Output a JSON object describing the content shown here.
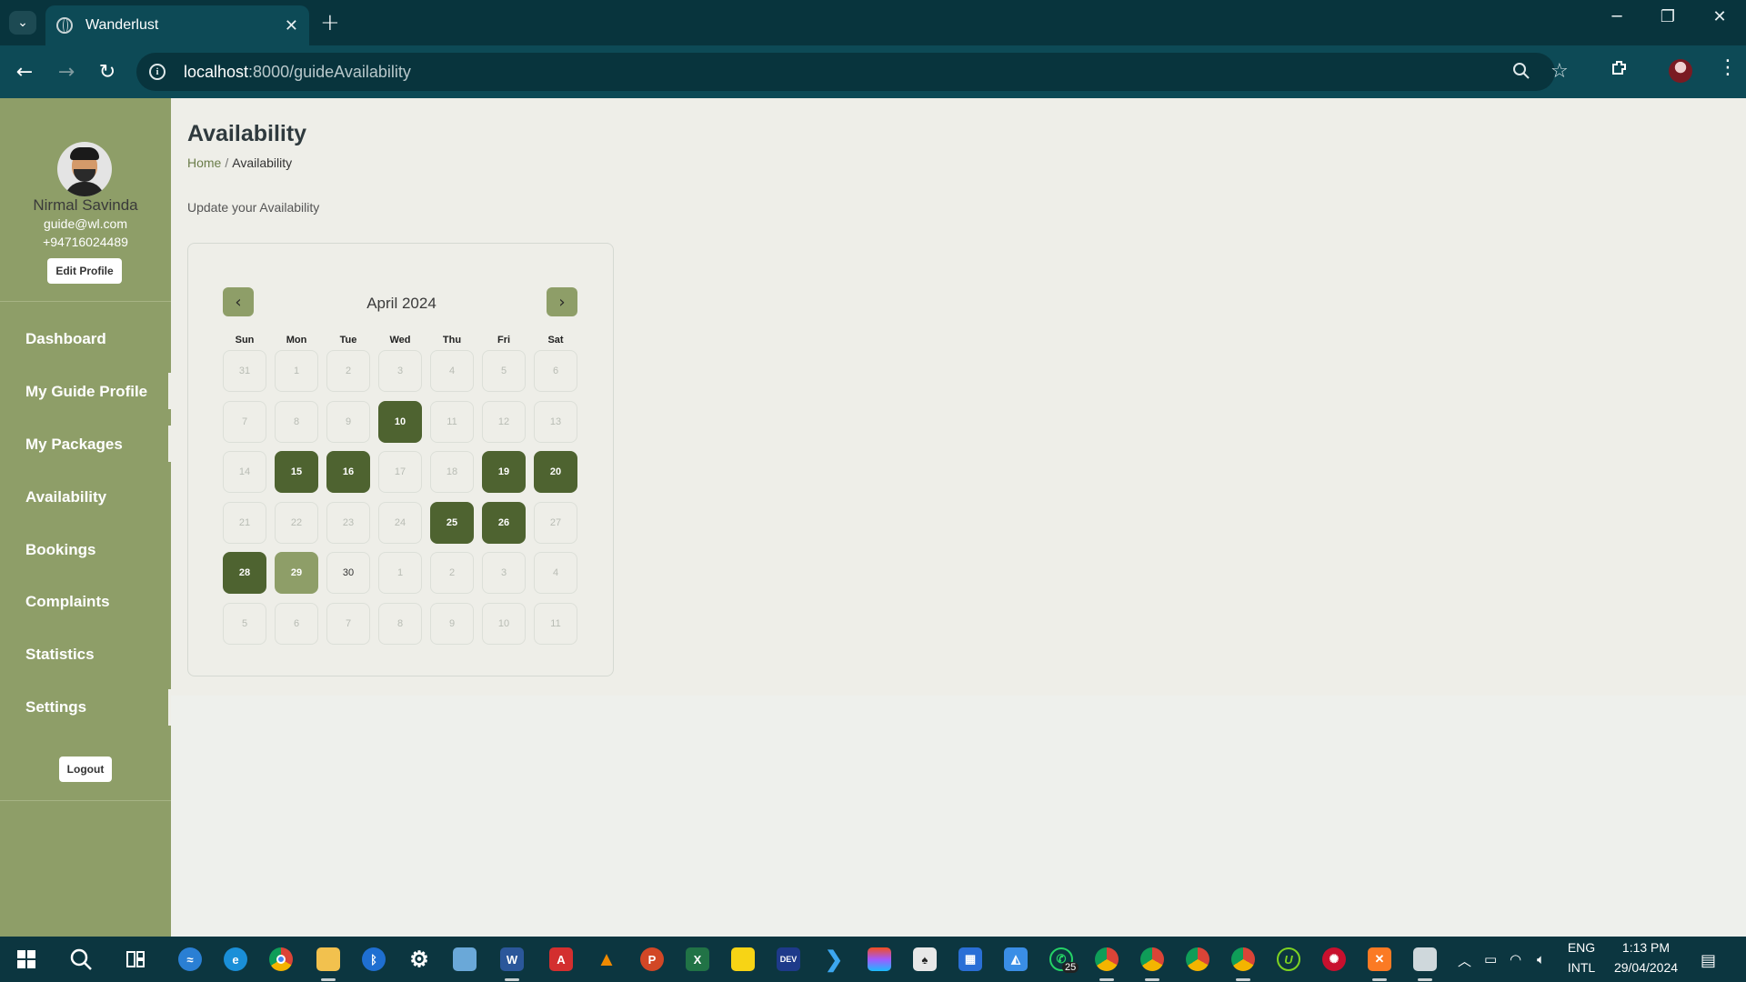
{
  "browser": {
    "tab_title": "Wanderlust",
    "url_host": "localhost",
    "url_path": ":8000/guideAvailability",
    "tab_close_glyph": "✕",
    "new_tab_glyph": "+",
    "controls": {
      "minimize": "─",
      "restore": "❐",
      "close": "✕"
    }
  },
  "sidebar": {
    "profile": {
      "name": "Nirmal Savinda",
      "email": "guide@wl.com",
      "phone": "+94716024489",
      "edit_label": "Edit Profile"
    },
    "items": [
      {
        "label": "Dashboard"
      },
      {
        "label": "My Guide Profile"
      },
      {
        "label": "My Packages"
      },
      {
        "label": "Availability"
      },
      {
        "label": "Bookings"
      },
      {
        "label": "Complaints"
      },
      {
        "label": "Statistics"
      },
      {
        "label": "Settings"
      }
    ],
    "logout_label": "Logout"
  },
  "page": {
    "title": "Availability",
    "breadcrumb": {
      "home": "Home",
      "separator": "/",
      "current": "Availability"
    },
    "subtitle": "Update your Availability"
  },
  "calendar": {
    "month_label": "April 2024",
    "prev_glyph": "‹",
    "next_glyph": "›",
    "weekdays": [
      "Sun",
      "Mon",
      "Tue",
      "Wed",
      "Thu",
      "Fri",
      "Sat"
    ],
    "weeks": [
      [
        {
          "d": "31",
          "s": "other"
        },
        {
          "d": "1",
          "s": "past"
        },
        {
          "d": "2",
          "s": "past"
        },
        {
          "d": "3",
          "s": "past"
        },
        {
          "d": "4",
          "s": "past"
        },
        {
          "d": "5",
          "s": "past"
        },
        {
          "d": "6",
          "s": "past"
        }
      ],
      [
        {
          "d": "7",
          "s": "past"
        },
        {
          "d": "8",
          "s": "past"
        },
        {
          "d": "9",
          "s": "past"
        },
        {
          "d": "10",
          "s": "avail"
        },
        {
          "d": "11",
          "s": "past"
        },
        {
          "d": "12",
          "s": "past"
        },
        {
          "d": "13",
          "s": "past"
        }
      ],
      [
        {
          "d": "14",
          "s": "past"
        },
        {
          "d": "15",
          "s": "avail"
        },
        {
          "d": "16",
          "s": "avail"
        },
        {
          "d": "17",
          "s": "past"
        },
        {
          "d": "18",
          "s": "past"
        },
        {
          "d": "19",
          "s": "avail"
        },
        {
          "d": "20",
          "s": "avail"
        }
      ],
      [
        {
          "d": "21",
          "s": "past"
        },
        {
          "d": "22",
          "s": "past"
        },
        {
          "d": "23",
          "s": "past"
        },
        {
          "d": "24",
          "s": "past"
        },
        {
          "d": "25",
          "s": "avail"
        },
        {
          "d": "26",
          "s": "avail"
        },
        {
          "d": "27",
          "s": "past"
        }
      ],
      [
        {
          "d": "28",
          "s": "avail"
        },
        {
          "d": "29",
          "s": "today"
        },
        {
          "d": "30",
          "s": "cur"
        },
        {
          "d": "1",
          "s": "other"
        },
        {
          "d": "2",
          "s": "other"
        },
        {
          "d": "3",
          "s": "other"
        },
        {
          "d": "4",
          "s": "other"
        }
      ],
      [
        {
          "d": "5",
          "s": "other"
        },
        {
          "d": "6",
          "s": "other"
        },
        {
          "d": "7",
          "s": "other"
        },
        {
          "d": "8",
          "s": "other"
        },
        {
          "d": "9",
          "s": "other"
        },
        {
          "d": "10",
          "s": "other"
        },
        {
          "d": "11",
          "s": "other"
        }
      ]
    ],
    "colors": {
      "available": "#4e6330",
      "today": "#8e9e68",
      "accent": "#8e9e68"
    }
  },
  "taskbar": {
    "whatsapp_badge": "25",
    "lang_top": "ENG",
    "lang_bottom": "INTL",
    "time": "1:13 PM",
    "date": "29/04/2024",
    "dev_label": "DEV"
  }
}
